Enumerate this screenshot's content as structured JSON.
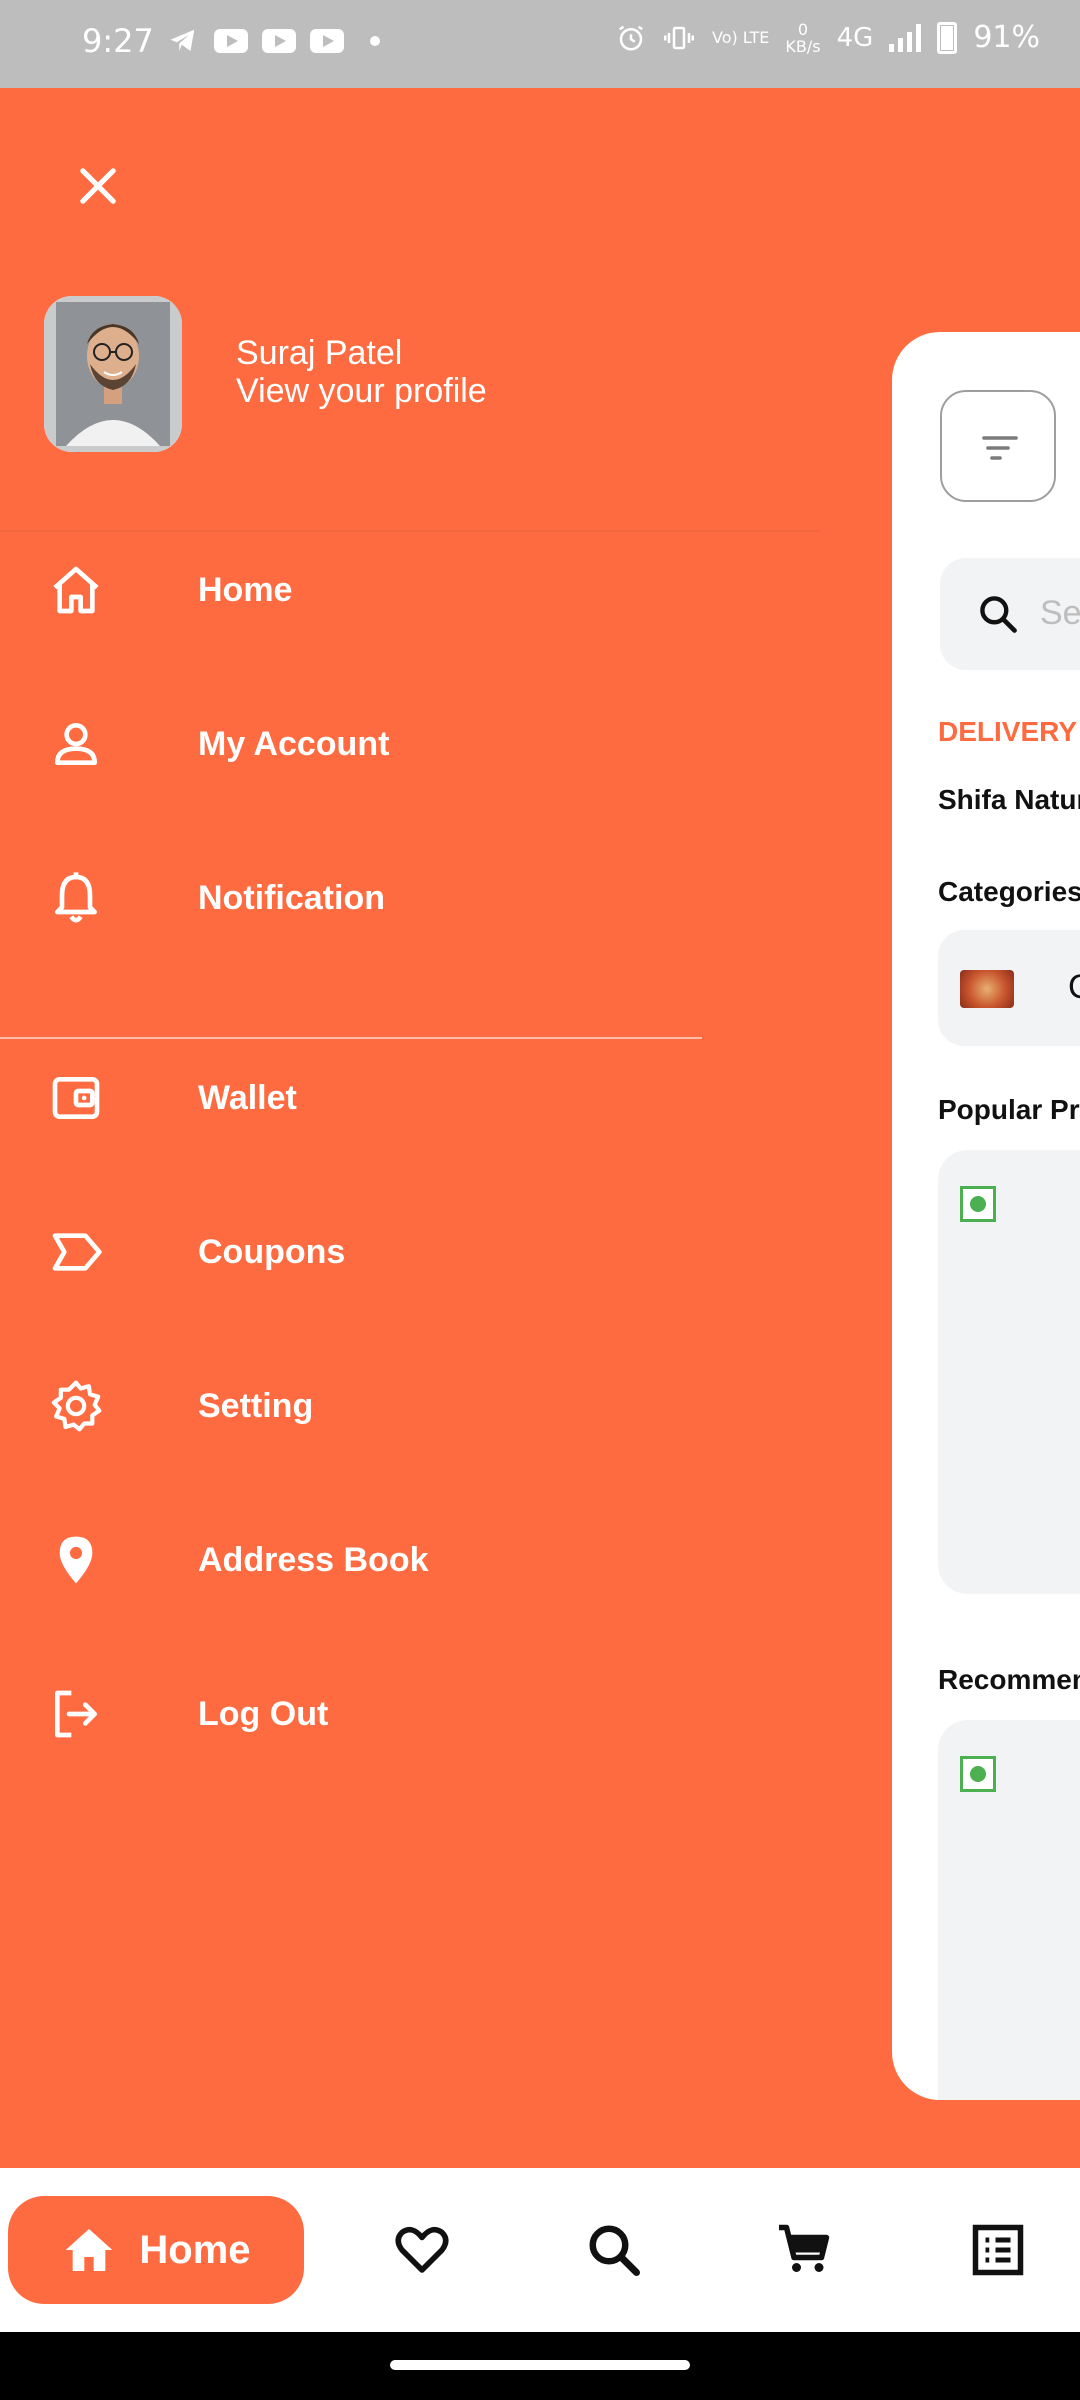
{
  "status_bar": {
    "time": "9:27",
    "network": "4G",
    "data_rate_value": "0",
    "data_rate_unit": "KB/s",
    "volte": "Vo) LTE",
    "battery": "91%"
  },
  "drawer": {
    "user_name": "Suraj Patel",
    "profile_link": "View your profile",
    "menu": [
      {
        "label": "Home",
        "icon": "home-icon"
      },
      {
        "label": "My Account",
        "icon": "user-icon"
      },
      {
        "label": "Notification",
        "icon": "bell-icon"
      },
      {
        "label": "Wallet",
        "icon": "wallet-icon"
      },
      {
        "label": "Coupons",
        "icon": "coupon-tag-icon"
      },
      {
        "label": "Setting",
        "icon": "gear-icon"
      },
      {
        "label": "Address Book",
        "icon": "location-pin-icon"
      },
      {
        "label": "Log Out",
        "icon": "logout-icon"
      }
    ]
  },
  "main_peek": {
    "search_placeholder": "Se",
    "delivery_label": "DELIVERY T",
    "address": "Shifa Nature",
    "categories_title": "Categories",
    "category_letter": "C",
    "popular_title": "Popular Pro",
    "recommended_title": "Recommen"
  },
  "bottom_nav": {
    "active_label": "Home",
    "items": [
      "home-icon",
      "heart-icon",
      "search-icon",
      "cart-icon",
      "orders-list-icon"
    ]
  },
  "colors": {
    "accent": "#FF6B40",
    "veg_green": "#4CAF50",
    "card_bg": "#F2F3F5"
  }
}
